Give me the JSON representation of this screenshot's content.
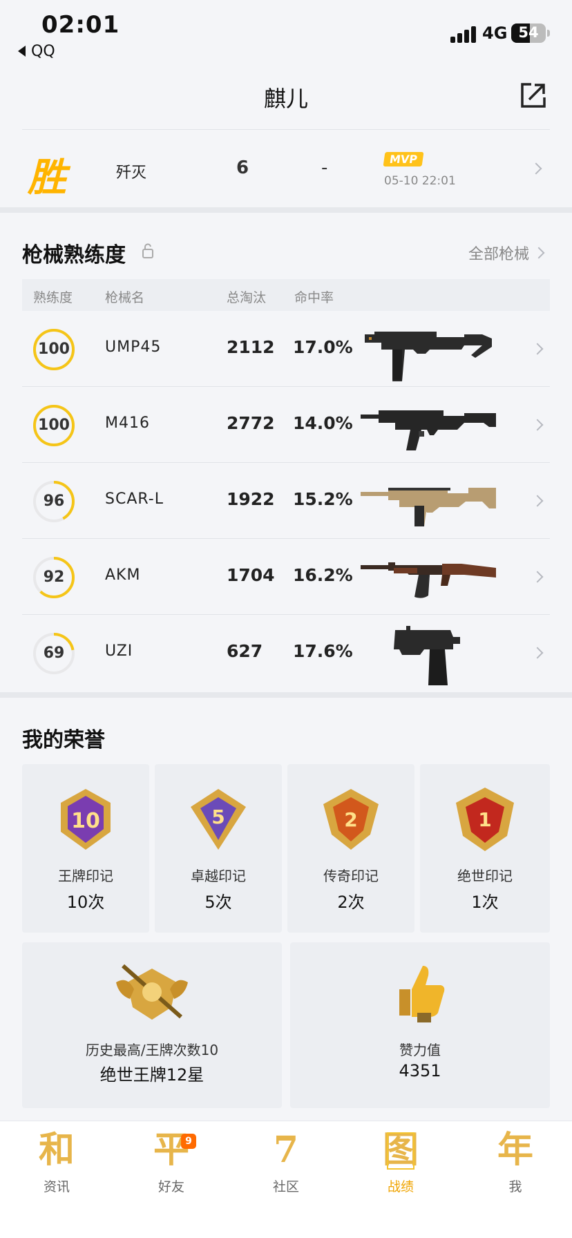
{
  "status": {
    "time": "02:01",
    "back_app": "QQ",
    "network": "4G",
    "battery": "54",
    "battery_level": 0.54
  },
  "header": {
    "title": "麒儿"
  },
  "match": {
    "result": "胜",
    "mode": "歼灭",
    "kills": "6",
    "extra": "-",
    "mvp": "MVP",
    "datetime": "05-10 22:01"
  },
  "weapons": {
    "title": "枪械熟练度",
    "all_link": "全部枪械",
    "columns": [
      "熟练度",
      "枪械名",
      "总淘汰",
      "命中率"
    ],
    "rows": [
      {
        "mastery": "100",
        "level": 1.0,
        "name": "UMP45",
        "kills": "2112",
        "rate": "17.0%",
        "gun": "ump-icon"
      },
      {
        "mastery": "100",
        "level": 1.0,
        "name": "M416",
        "kills": "2772",
        "rate": "14.0%",
        "gun": "m416-icon"
      },
      {
        "mastery": "96",
        "level": 0.42,
        "name": "SCAR-L",
        "kills": "1922",
        "rate": "15.2%",
        "gun": "scar-icon"
      },
      {
        "mastery": "92",
        "level": 0.62,
        "name": "AKM",
        "kills": "1704",
        "rate": "16.2%",
        "gun": "akm-icon"
      },
      {
        "mastery": "69",
        "level": 0.22,
        "name": "UZI",
        "kills": "627",
        "rate": "17.6%",
        "gun": "uzi-icon"
      }
    ]
  },
  "honors": {
    "title": "我的荣誉",
    "badges": [
      {
        "label": "王牌印记",
        "count": "10次",
        "num": "10",
        "color": "#7a3db0"
      },
      {
        "label": "卓越印记",
        "count": "5次",
        "num": "5",
        "color": "#6b4bb8"
      },
      {
        "label": "传奇印记",
        "count": "2次",
        "num": "2",
        "color": "#d2581c"
      },
      {
        "label": "绝世印记",
        "count": "1次",
        "num": "1",
        "color": "#c2281e"
      }
    ],
    "best": {
      "label": "历史最高/王牌次数10",
      "value": "绝世王牌12星"
    },
    "likes": {
      "label": "赞力值",
      "value": "4351"
    }
  },
  "tabs": [
    {
      "glyph": "和",
      "label": "资讯"
    },
    {
      "glyph": "平",
      "label": "好友",
      "badge": "9"
    },
    {
      "glyph": "7",
      "label": "社区"
    },
    {
      "glyph": "图",
      "label": "战绩",
      "active": true
    },
    {
      "glyph": "年",
      "label": "我"
    }
  ],
  "colors": {
    "accent": "#ffb400",
    "ring": "#f5c518",
    "tab_active": "#f0a400"
  }
}
